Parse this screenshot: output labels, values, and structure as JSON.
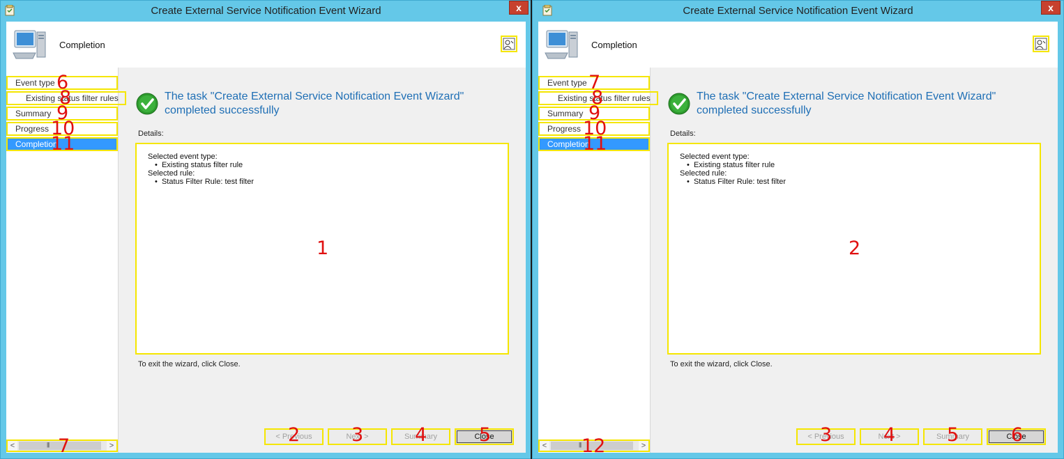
{
  "colors": {
    "window_frame": "#64c8e8",
    "close_button": "#c7412e",
    "highlight_box": "#f5e600",
    "overlay_number": "#e01010",
    "nav_active": "#3399ff",
    "success_title": "#1f6fb5"
  },
  "windows": [
    {
      "title": "Create External Service Notification Event Wizard",
      "close_glyph": "x",
      "header_title": "Completion",
      "nav": {
        "items": [
          {
            "label": "Event type",
            "num": "6"
          },
          {
            "label": "Existing status filter rules",
            "num": "8"
          },
          {
            "label": "Summary",
            "num": "9"
          },
          {
            "label": "Progress",
            "num": "10"
          },
          {
            "label": "Completion",
            "num": "11"
          }
        ],
        "scroll_num": "7",
        "scroll_left": "<",
        "scroll_right": ">"
      },
      "success_title": "The task \"Create External Service Notification Event Wizard\" completed successfully",
      "details_label": "Details:",
      "details": {
        "line1": "Selected event type:",
        "line2": "Existing status filter rule",
        "line3": "Selected rule:",
        "line4": "Status Filter Rule: test filter"
      },
      "details_num": "1",
      "exit_text": "To exit the wizard, click Close.",
      "buttons": {
        "previous": "< Previous",
        "next": "Next >",
        "summary": "Summary",
        "close": "Close"
      },
      "button_nums": {
        "previous": "2",
        "next": "3",
        "summary": "4",
        "close": "5"
      }
    },
    {
      "title": "Create External Service Notification Event Wizard",
      "close_glyph": "x",
      "header_title": "Completion",
      "nav": {
        "items": [
          {
            "label": "Event type",
            "num": "7"
          },
          {
            "label": "Existing status filter rules",
            "num": "8"
          },
          {
            "label": "Summary",
            "num": "9"
          },
          {
            "label": "Progress",
            "num": "10"
          },
          {
            "label": "Completion",
            "num": "11"
          }
        ],
        "scroll_num": "12",
        "scroll_left": "<",
        "scroll_right": ">"
      },
      "success_title": "The task \"Create External Service Notification Event Wizard\" completed successfully",
      "details_label": "Details:",
      "details": {
        "line1": "Selected event type:",
        "line2": "Existing status filter rule",
        "line3": "Selected rule:",
        "line4": "Status Filter Rule: test filter"
      },
      "details_num": "2",
      "exit_text": "To exit the wizard, click Close.",
      "buttons": {
        "previous": "< Previous",
        "next": "Next >",
        "summary": "Summary",
        "close": "Close"
      },
      "button_nums": {
        "previous": "3",
        "next": "4",
        "summary": "5",
        "close": "6"
      }
    }
  ]
}
